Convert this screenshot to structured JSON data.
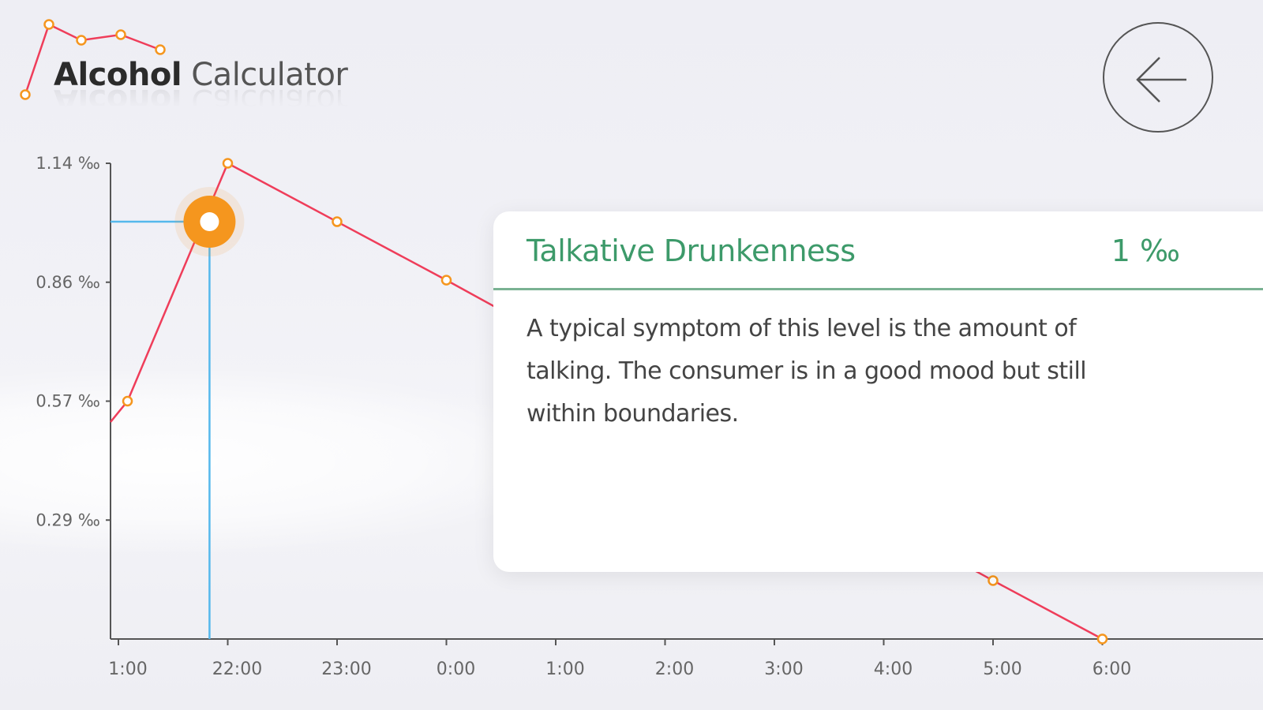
{
  "app": {
    "title_bold": "Alcohol",
    "title_light": "Calculator",
    "back_icon": "arrow-left-icon"
  },
  "colors": {
    "line": "#ef3d5a",
    "marker": "#f5961e",
    "crosshair": "#55b8ec",
    "accent_green": "#3d9a6a"
  },
  "chart_data": {
    "type": "line",
    "title": "",
    "xlabel": "",
    "ylabel": "",
    "unit": "‰",
    "x_ticks": [
      "1:00",
      "22:00",
      "23:00",
      "0:00",
      "1:00",
      "2:00",
      "3:00",
      "4:00",
      "5:00",
      "6:00"
    ],
    "y_ticks": [
      "1.14 ‰",
      "0.86 ‰",
      "0.57 ‰",
      "0.29 ‰"
    ],
    "ylim": [
      0,
      1.14
    ],
    "series": [
      {
        "values": [
          {
            "x": "21:00",
            "y": 0.52
          },
          {
            "x": "21:05",
            "y": 0.57
          },
          {
            "x": "22:00",
            "y": 1.14
          },
          {
            "x": "23:00",
            "y": 1.0
          },
          {
            "x": "0:00",
            "y": 0.86
          },
          {
            "x": "5:00",
            "y": 0.14
          },
          {
            "x": "6:00",
            "y": 0.0
          }
        ]
      }
    ],
    "selected": {
      "x": "21:50",
      "y": 1.0
    }
  },
  "info_card": {
    "level_name": "Talkative Drunkenness",
    "level_value": "1 ‰",
    "description": "A typical symptom of this level is the amount of talking. The consumer is in a good mood but still within boundaries."
  }
}
